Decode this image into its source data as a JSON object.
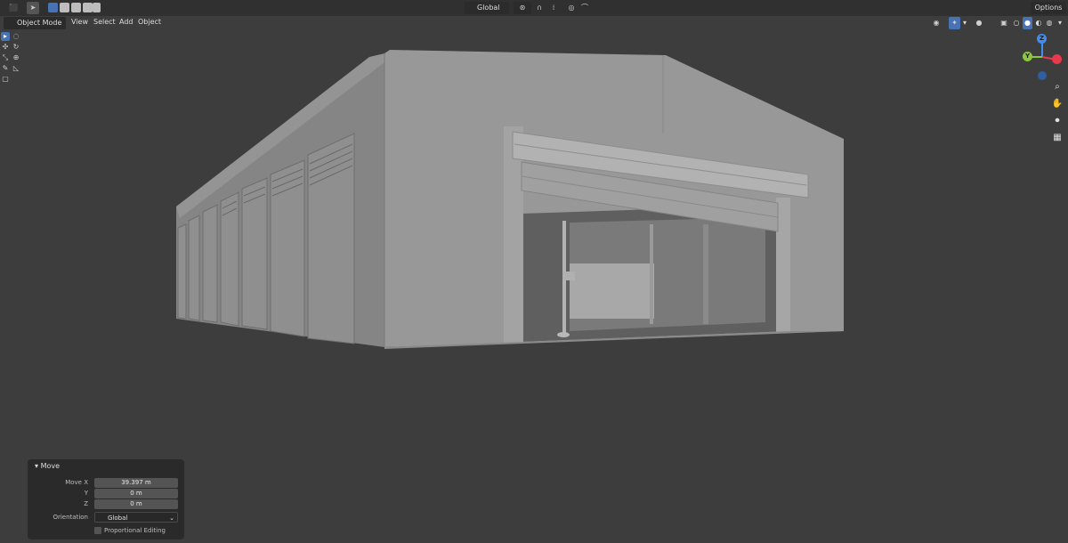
{
  "header": {
    "mode_label": "Object Mode",
    "menus": [
      "View",
      "Select",
      "Add",
      "Object"
    ],
    "transform_orientation": "Global",
    "options_label": "Options"
  },
  "icons": {
    "editor_type": "cube-editor-icon",
    "select_tool": "select-cursor-icon",
    "snap": "magnet-icon",
    "proportional": "proportional-editing-icon",
    "falloff": "falloff-curve-icon",
    "overlay": "overlay-icon",
    "gizmo_toggle": "gizmo-toggle-icon",
    "xray": "xray-icon",
    "zoom": "zoom-icon",
    "pan": "hand-pan-icon",
    "camera": "camera-icon",
    "perspective": "perspective-grid-icon"
  },
  "gizmo": {
    "z": "Z",
    "y": "Y",
    "x": ""
  },
  "operator_panel": {
    "title": "Move",
    "move_x_label": "Move X",
    "move_x_value": "39.397 m",
    "y_label": "Y",
    "y_value": "0 m",
    "z_label": "Z",
    "z_value": "0 m",
    "orientation_label": "Orientation",
    "orientation_value": "Global",
    "proportional_label": "Proportional Editing"
  },
  "colors": {
    "accent": "#4772b3",
    "viewport_bg": "#3d3d3d",
    "header_bg": "#303030",
    "axis_x": "#e8394d",
    "axis_y": "#8cc63f",
    "axis_z": "#3f8df0"
  }
}
